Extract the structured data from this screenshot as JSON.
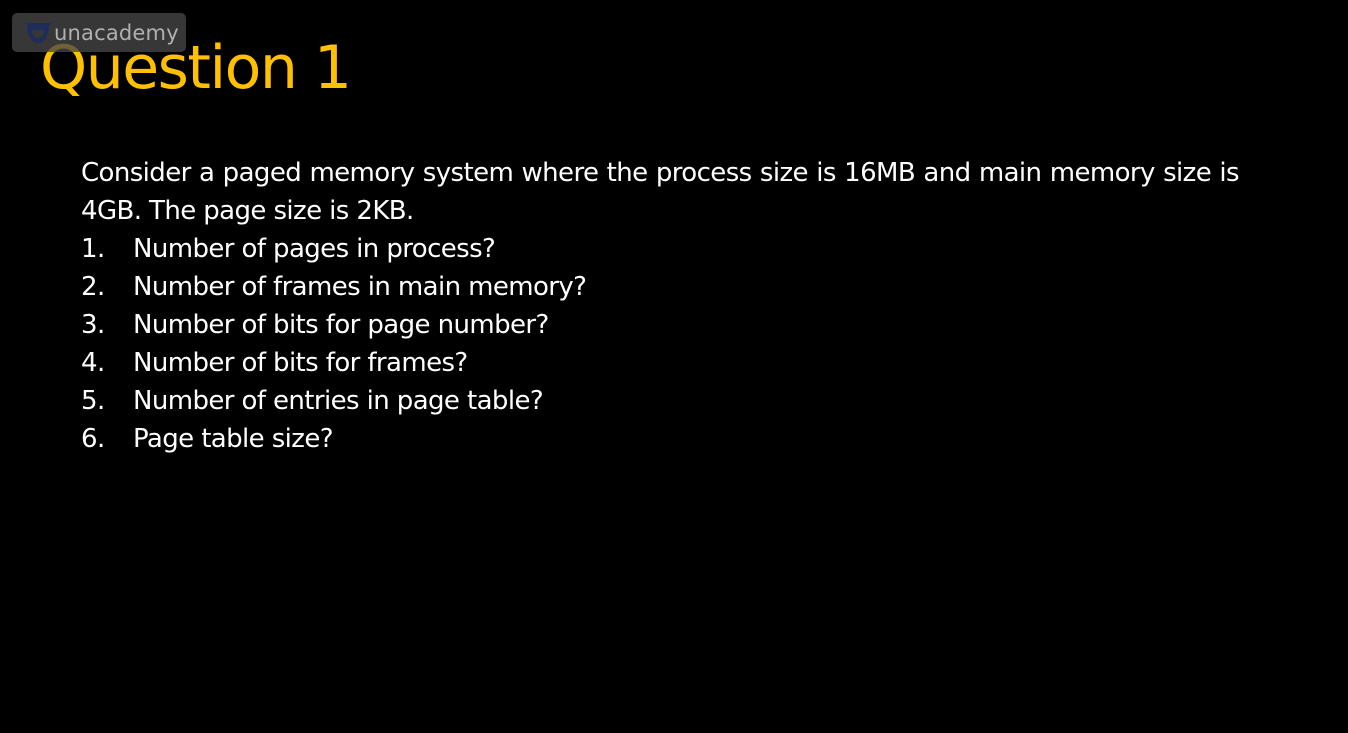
{
  "watermark": {
    "brand": "unacademy",
    "icon": "unacademy-logo-icon"
  },
  "slide": {
    "title": "Question 1",
    "question_text": "Consider a paged memory system where the process size is 16MB and main memory size is 4GB. The page size is 2KB.",
    "items": [
      {
        "number": "1.",
        "text": "Number of pages in process?"
      },
      {
        "number": "2.",
        "text": "Number of frames in main memory?"
      },
      {
        "number": "3.",
        "text": "Number of bits for page number?"
      },
      {
        "number": "4.",
        "text": "Number of bits for frames?"
      },
      {
        "number": "5.",
        "text": "Number of entries in page table?"
      },
      {
        "number": "6.",
        "text": "Page table size?"
      }
    ]
  },
  "colors": {
    "background": "#000000",
    "title": "#ffc000",
    "text": "#ffffff",
    "watermark_bg": "#464646",
    "watermark_text": "#b0b0b0"
  }
}
